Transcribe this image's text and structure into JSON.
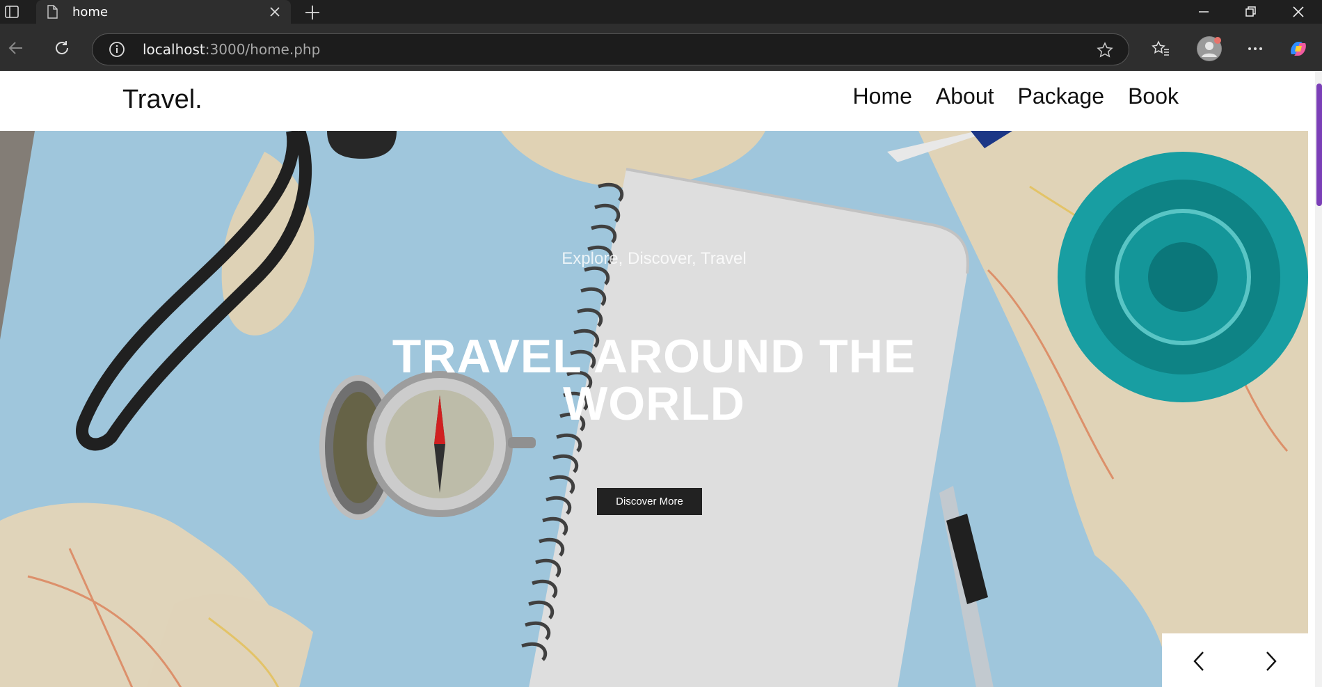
{
  "browser": {
    "tab_title": "home",
    "url_host": "localhost",
    "url_rest": ":3000/home.php"
  },
  "site": {
    "logo": "Travel.",
    "nav": [
      "Home",
      "About",
      "Package",
      "Book"
    ]
  },
  "hero": {
    "tagline": "Explore, Discover, Travel",
    "headline": "TRAVEL AROUND THE WORLD",
    "cta_label": "Discover More"
  },
  "colors": {
    "accent_scroll": "#7b3fb7",
    "cta_bg": "#222222",
    "map_sea": "#a9d3ea"
  },
  "icons": [
    "sidebar-toggle-icon",
    "document-icon",
    "close-icon",
    "plus-icon",
    "minimize-icon",
    "restore-icon",
    "window-close-icon",
    "back-arrow-icon",
    "refresh-icon",
    "info-icon",
    "star-icon",
    "favorites-icon",
    "profile-icon",
    "more-icon",
    "copilot-icon",
    "chevron-left-icon",
    "chevron-right-icon"
  ]
}
